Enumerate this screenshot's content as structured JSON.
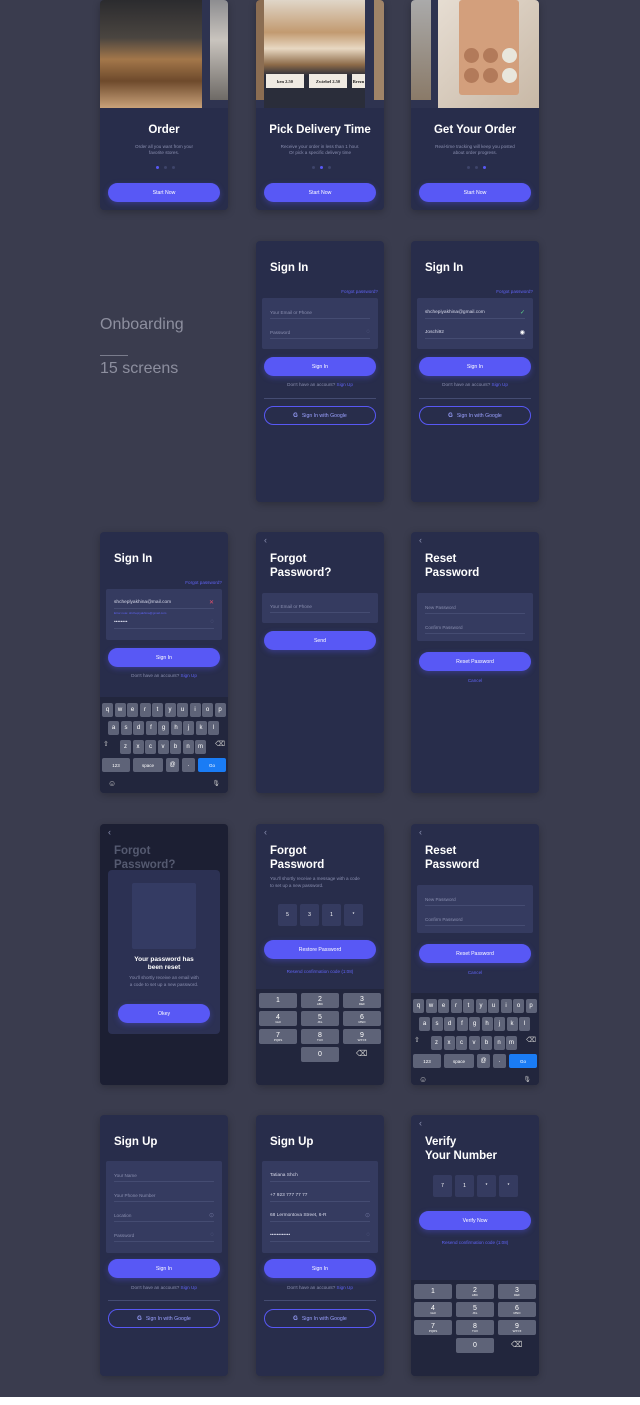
{
  "side": {
    "section": "Onboarding",
    "count": "15 screens"
  },
  "colors": {
    "background": "#3a3c4e",
    "card": "#282d4b",
    "accent": "#5858f5",
    "field": "#353b60"
  },
  "screens": [
    {
      "kind": "onboarding",
      "title": "Order",
      "desc": [
        "Order all you want from your",
        "favorite stores."
      ],
      "active_dot": 0,
      "button": "Start Now",
      "photo": "bakery-icon"
    },
    {
      "kind": "onboarding",
      "title": "Pick Delivery Time",
      "desc": [
        "Receive your order in less than 1 hour.",
        "Or pick a specific delivery time"
      ],
      "active_dot": 1,
      "button": "Start Now",
      "photo": "bread-counter-icon",
      "price_labels": [
        "ken 2.50",
        "Zwiebel 2.50",
        "Brezn"
      ]
    },
    {
      "kind": "onboarding",
      "title": "Get Your Order",
      "desc": [
        "Real-time tracking will keep you posted",
        "about order progress."
      ],
      "active_dot": 2,
      "button": "Start Now",
      "photo": "eggs-icon"
    },
    {
      "kind": "signin",
      "title": "Sign In",
      "forgot": "Forgot password?",
      "fields": [
        {
          "placeholder": "Your Email or Phone",
          "value": "",
          "icon": ""
        },
        {
          "placeholder": "Password",
          "value": "",
          "icon": "eye-off-icon"
        }
      ],
      "button": "Sign In",
      "no_account": "Don't have an account?",
      "signup": "Sign Up",
      "google": "Sign In with Google"
    },
    {
      "kind": "signin",
      "title": "Sign In",
      "forgot": "Forgot password?",
      "fields": [
        {
          "placeholder": "",
          "value": "shchepiyakhina@gmail.com",
          "icon": "check-icon"
        },
        {
          "placeholder": "",
          "value": "Joschi92",
          "icon": "eye-icon"
        }
      ],
      "button": "Sign In",
      "no_account": "Don't have an account?",
      "signup": "Sign Up",
      "google": "Sign In with Google"
    },
    {
      "kind": "signin_error",
      "title": "Sign In",
      "forgot": "Forgot password?",
      "email": "shcheplyakhina@mail.com",
      "error": "Error note: shchepiyakhina@gmail.com",
      "password": "••••••••",
      "button": "Sign In",
      "no_account": "Don't have an account?",
      "signup": "Sign Up"
    },
    {
      "kind": "forgot",
      "title": [
        "Forgot",
        "Password?"
      ],
      "placeholder": "Your Email or Phone",
      "button": "Send"
    },
    {
      "kind": "reset",
      "title": [
        "Reset",
        "Password"
      ],
      "fields": [
        "New Password",
        "Confirm Password"
      ],
      "button": "Reset Password",
      "cancel": "Cancel"
    },
    {
      "kind": "modal",
      "title": [
        "Forgot",
        "Password?"
      ],
      "heading": [
        "Your password has",
        "been reset"
      ],
      "text": [
        "You'll shortly receive an email with",
        "a code to set up a new password."
      ],
      "button": "Okey"
    },
    {
      "kind": "code",
      "title": [
        "Forgot",
        "Password"
      ],
      "desc": [
        "You'll shortly receive a message with a code",
        "to set up a new password."
      ],
      "code": [
        "5",
        "3",
        "1",
        "*"
      ],
      "button": "Restore Password",
      "resend": "Resend confirmation code (1:08)"
    },
    {
      "kind": "reset",
      "title": [
        "Reset",
        "Password"
      ],
      "fields": [
        "New Password",
        "Confirm Password"
      ],
      "button": "Reset Password",
      "cancel": "Cancel",
      "keyboard": true
    },
    {
      "kind": "signup",
      "title": "Sign Up",
      "fields": [
        {
          "placeholder": "Your Name",
          "value": "",
          "icon": ""
        },
        {
          "placeholder": "Your Phone Number",
          "value": "",
          "icon": ""
        },
        {
          "placeholder": "Location",
          "value": "",
          "icon": "location-pin-icon"
        },
        {
          "placeholder": "Password",
          "value": "",
          "icon": "eye-off-icon"
        }
      ],
      "button": "Sign In",
      "no_account": "Don't have an account?",
      "signup": "Sign Up",
      "google": "Sign In with Google"
    },
    {
      "kind": "signup",
      "title": "Sign Up",
      "fields": [
        {
          "placeholder": "",
          "value": "Tatiana Shch",
          "icon": ""
        },
        {
          "placeholder": "",
          "value": "+7 923 777 77 77",
          "icon": ""
        },
        {
          "placeholder": "",
          "value": "68 Lermontova Street, 6-R",
          "icon": "location-pin-icon"
        },
        {
          "placeholder": "",
          "value": "••••••••••••",
          "icon": "eye-off-icon"
        }
      ],
      "button": "Sign In",
      "no_account": "Don't have an account?",
      "signup": "Sign Up",
      "google": "Sign In with Google"
    },
    {
      "kind": "verify",
      "title": [
        "Verify",
        "Your Number"
      ],
      "code": [
        "7",
        "1",
        "*",
        "*"
      ],
      "button": "Verify Now",
      "resend": "Resend confirmation code (1:08)"
    }
  ],
  "keyboard": {
    "rows": [
      "qwertyuiop",
      "asdfghjkl",
      "zxcvbnm"
    ],
    "num": "123",
    "space": "space",
    "at": "@",
    "dot": ".",
    "go": "Go"
  },
  "numpad": [
    {
      "n": "1",
      "l": ""
    },
    {
      "n": "2",
      "l": "ABC"
    },
    {
      "n": "3",
      "l": "DEF"
    },
    {
      "n": "4",
      "l": "GHI"
    },
    {
      "n": "5",
      "l": "JKL"
    },
    {
      "n": "6",
      "l": "MNO"
    },
    {
      "n": "7",
      "l": "PQRS"
    },
    {
      "n": "8",
      "l": "TUV"
    },
    {
      "n": "9",
      "l": "WXYZ"
    },
    {
      "n": "0",
      "l": ""
    }
  ]
}
